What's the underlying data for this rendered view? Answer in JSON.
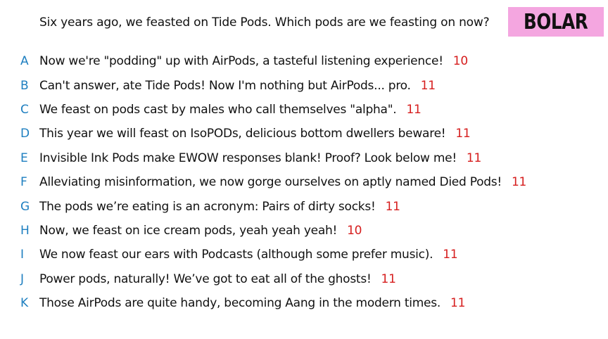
{
  "prompt": "Six years ago, we feasted on Tide Pods. Which pods are we feasting on now?",
  "badge": {
    "label": "BOLAR",
    "color": "#f4a6e0"
  },
  "colors": {
    "letter": "#1e7fc0",
    "score": "#d61e1e"
  },
  "responses": [
    {
      "letter": "A",
      "text": "Now we're \"podding\" up with AirPods, a tasteful listening experience!",
      "words": "10"
    },
    {
      "letter": "B",
      "text": "Can't answer, ate Tide Pods! Now I'm nothing but AirPods... pro.",
      "words": "11"
    },
    {
      "letter": "C",
      "text": "We feast on pods cast by males who call themselves \"alpha\".",
      "words": "11"
    },
    {
      "letter": "D",
      "text": "This year we will feast on IsoPODs, delicious bottom dwellers beware!",
      "words": "11"
    },
    {
      "letter": "E",
      "text": "Invisible Ink Pods make EWOW responses blank! Proof? Look below me!",
      "words": "11"
    },
    {
      "letter": "F",
      "text": "Alleviating misinformation, we now gorge ourselves on aptly named Died Pods!",
      "words": "11"
    },
    {
      "letter": "G",
      "text": "The pods we’re eating is an acronym: Pairs of dirty socks!",
      "words": "11"
    },
    {
      "letter": "H",
      "text": "Now, we feast on ice cream pods, yeah yeah yeah!",
      "words": "10"
    },
    {
      "letter": "I",
      "text": "We now feast our ears with Podcasts (although some prefer music).",
      "words": "11"
    },
    {
      "letter": "J",
      "text": "Power pods, naturally! We’ve got to eat all of the ghosts!",
      "words": "11"
    },
    {
      "letter": "K",
      "text": "Those AirPods are quite handy, becoming Aang in the modern times.",
      "words": "11"
    }
  ]
}
